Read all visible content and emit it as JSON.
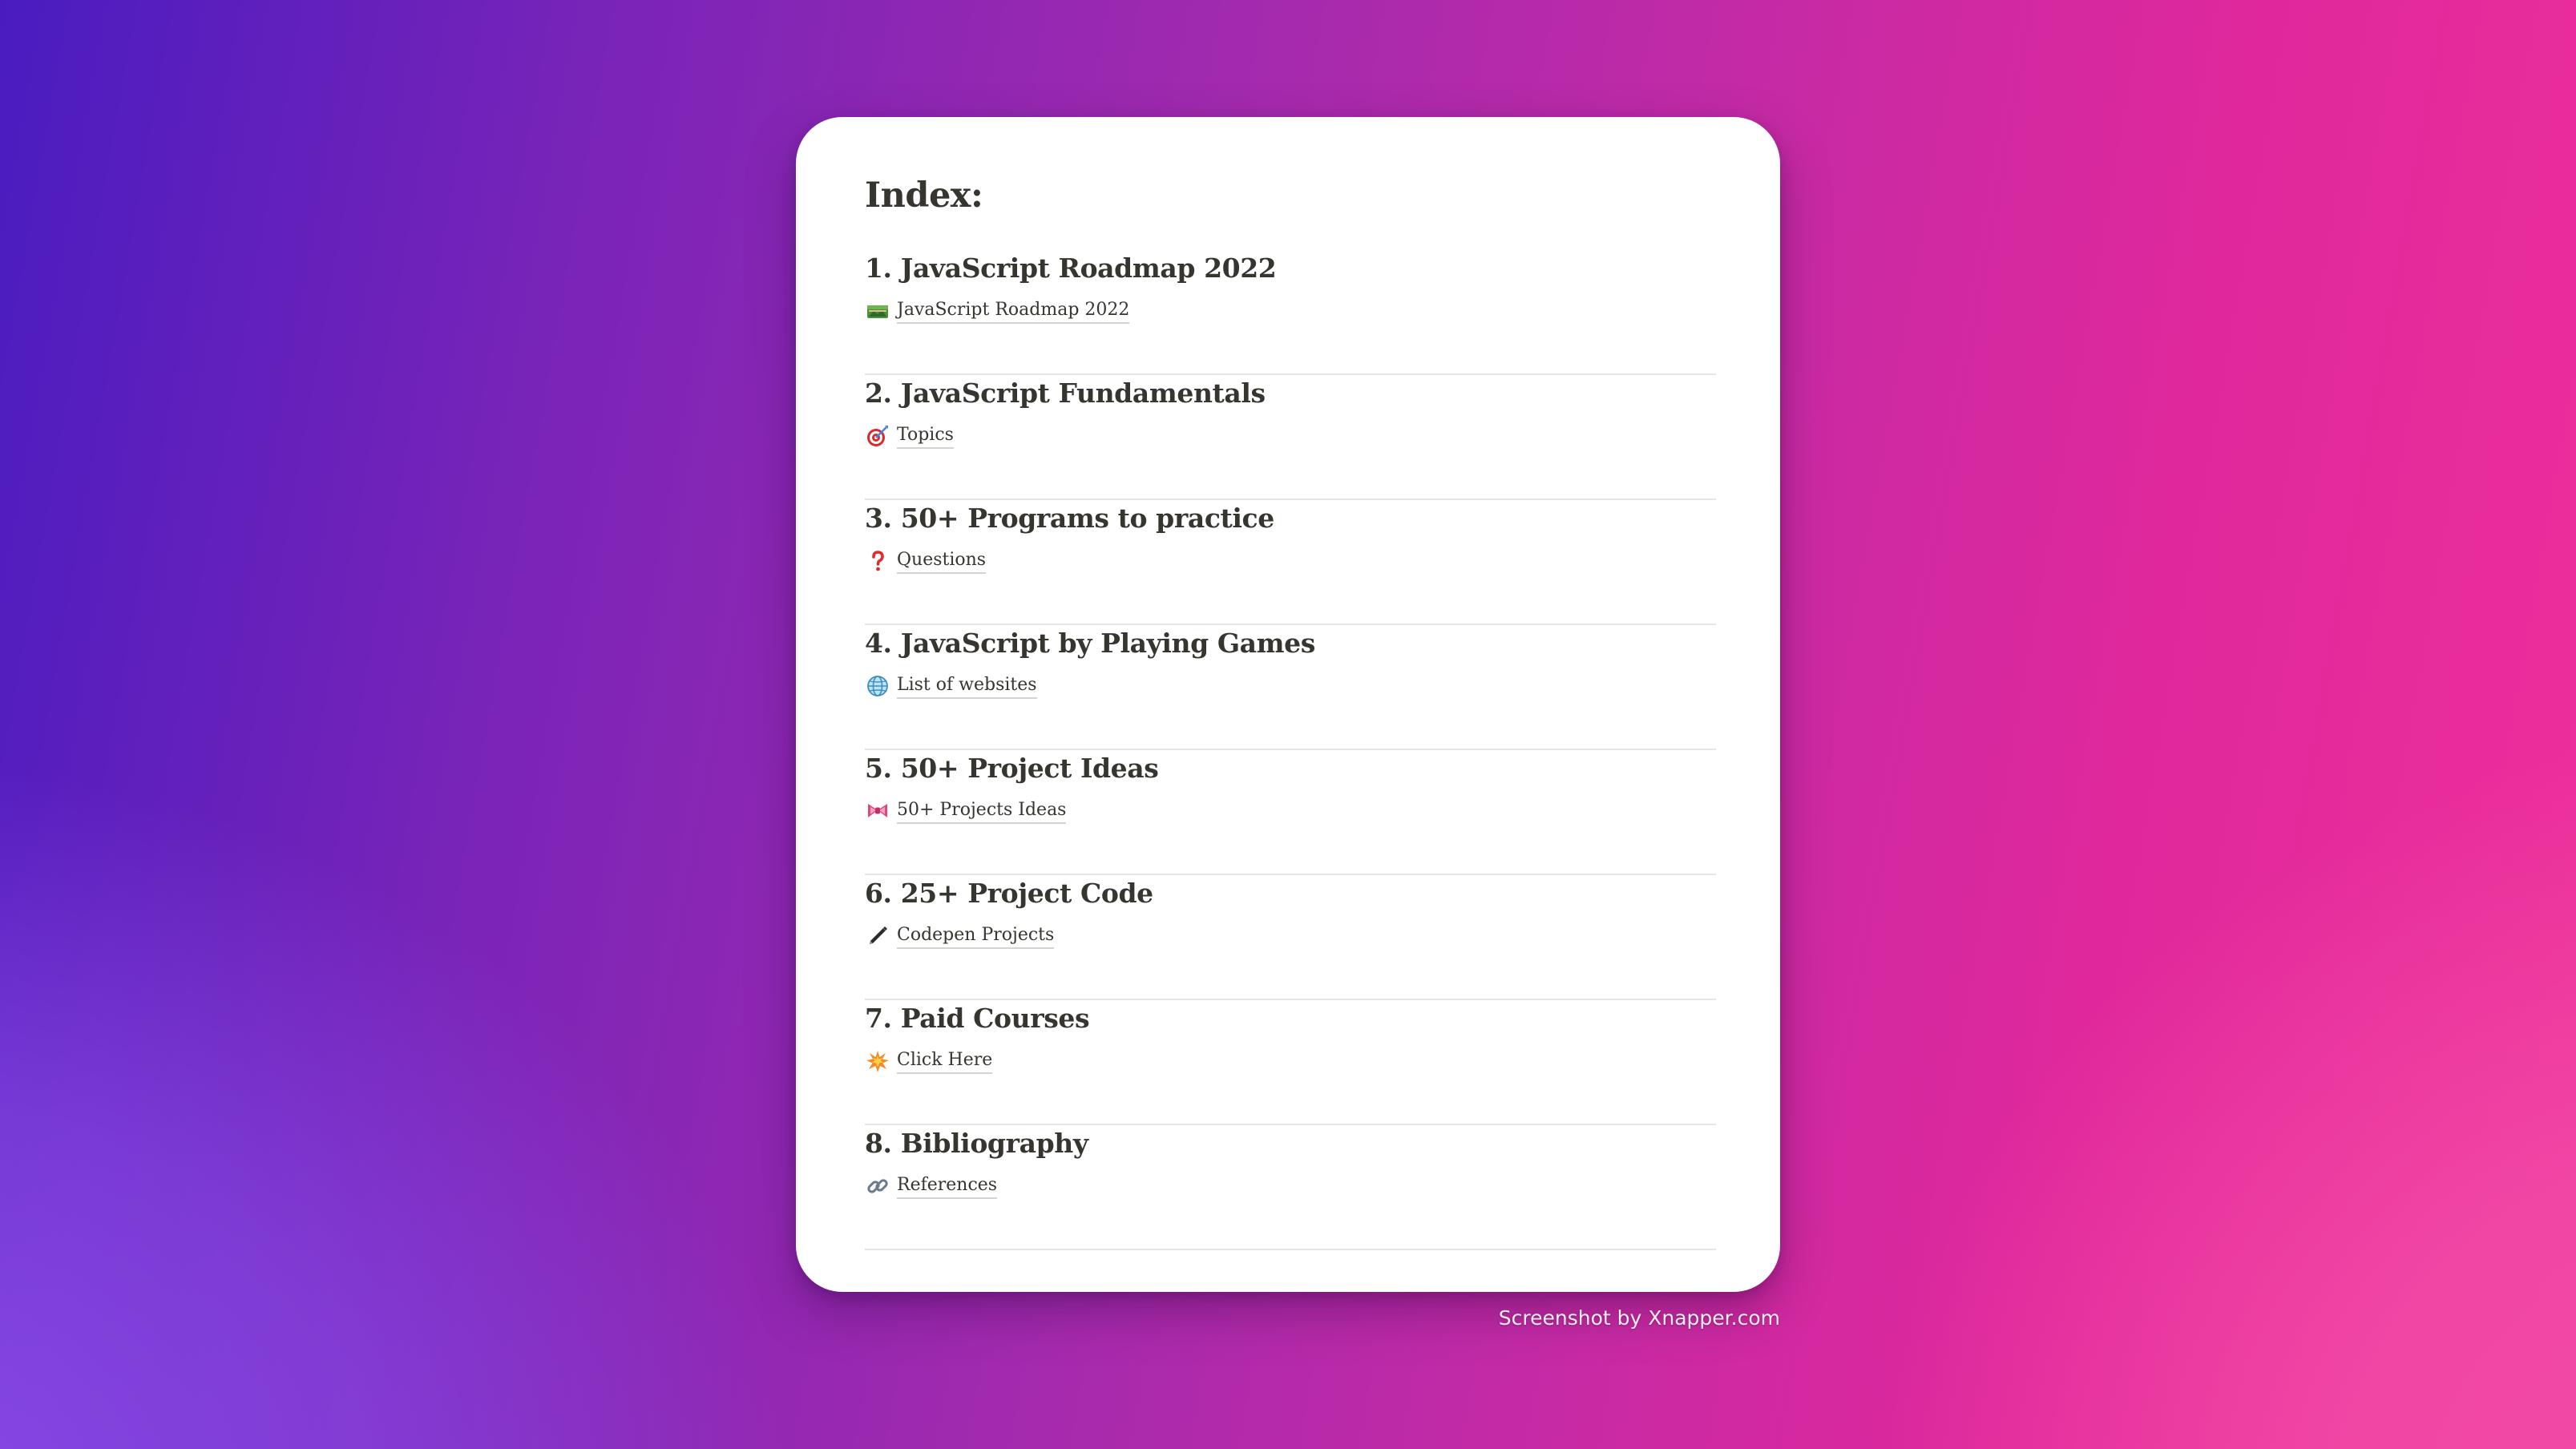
{
  "index": {
    "title": "Index:"
  },
  "sections": [
    {
      "heading": "1. JavaScript Roadmap 2022",
      "link_icon": "map-icon",
      "link_label": "JavaScript Roadmap 2022"
    },
    {
      "heading": "2. JavaScript Fundamentals",
      "link_icon": "target-icon",
      "link_label": "Topics"
    },
    {
      "heading": "3. 50+ Programs to practice",
      "link_icon": "question-mark-icon",
      "link_label": "Questions"
    },
    {
      "heading": "4. JavaScript by Playing Games",
      "link_icon": "globe-icon",
      "link_label": "List of websites"
    },
    {
      "heading": "5. 50+ Project Ideas",
      "link_icon": "ribbon-icon",
      "link_label": "50+ Projects Ideas"
    },
    {
      "heading": "6. 25+ Project Code",
      "link_icon": "pen-icon",
      "link_label": "Codepen Projects"
    },
    {
      "heading": "7. Paid Courses",
      "link_icon": "burst-icon",
      "link_label": "Click Here"
    },
    {
      "heading": "8. Bibliography",
      "link_icon": "link-icon",
      "link_label": "References"
    }
  ],
  "footer": {
    "watermark": "Screenshot by Xnapper.com"
  }
}
